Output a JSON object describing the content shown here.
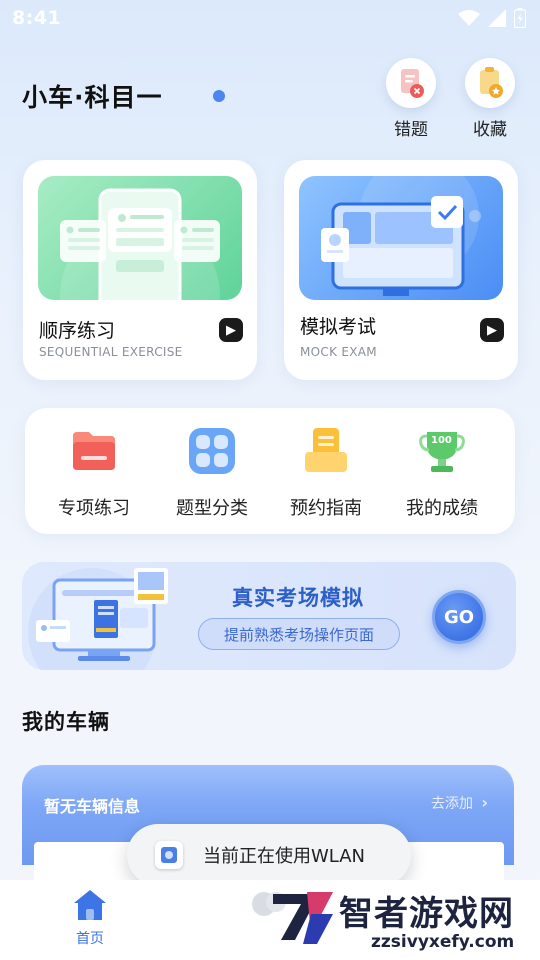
{
  "status_bar": {
    "time": "8:41"
  },
  "header": {
    "title": "小车·科目一",
    "actions": [
      {
        "label": "错题",
        "icon": "wrong-questions-icon"
      },
      {
        "label": "收藏",
        "icon": "favorites-icon"
      }
    ]
  },
  "cards": [
    {
      "title": "顺序练习",
      "subtitle": "SEQUENTIAL EXERCISE"
    },
    {
      "title": "模拟考试",
      "subtitle": "MOCK EXAM"
    }
  ],
  "quick_menu": [
    {
      "label": "专项练习",
      "icon": "folder-icon"
    },
    {
      "label": "题型分类",
      "icon": "grid-icon"
    },
    {
      "label": "预约指南",
      "icon": "clipboard-icon"
    },
    {
      "label": "我的成绩",
      "icon": "trophy-icon",
      "badge": "100"
    }
  ],
  "banner": {
    "title": "真实考场模拟",
    "subtitle": "提前熟悉考场操作页面",
    "button": "GO"
  },
  "vehicles": {
    "section_title": "我的车辆",
    "empty_text": "暂无车辆信息",
    "add_label": "去添加"
  },
  "toast": {
    "message": "当前正在使用WLAN"
  },
  "bottom_nav": {
    "home_label": "首页"
  },
  "watermark": {
    "brand": "智者游戏网",
    "url": "zzsivyxefy.com"
  },
  "colors": {
    "accent": "#3d74e6",
    "banner_title": "#2d5fc9",
    "background": "#e9f1fc"
  }
}
